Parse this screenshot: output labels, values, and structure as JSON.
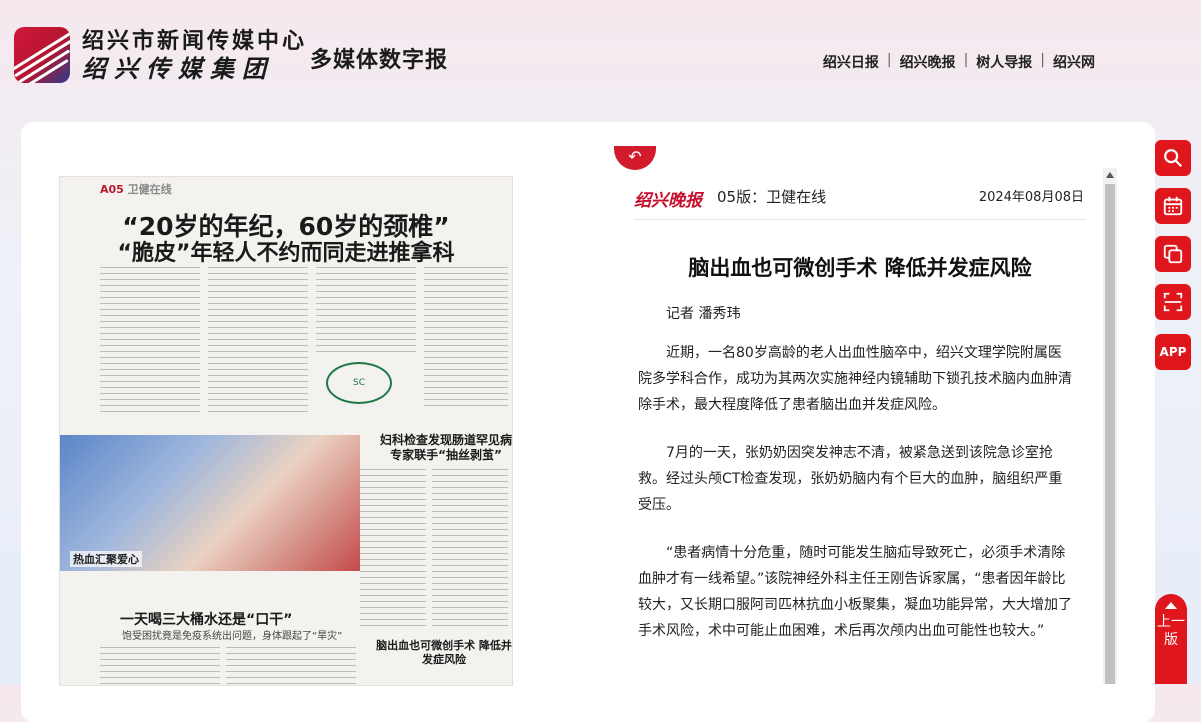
{
  "header": {
    "org_name_line1": "绍兴市新闻传媒中心",
    "org_name_line2": "绍兴传媒集团",
    "product_title": "多媒体数字报",
    "nav": [
      "绍兴日报",
      "绍兴晚报",
      "树人导报",
      "绍兴网"
    ]
  },
  "newspaper_page": {
    "page_tag": "A05",
    "section": "卫健在线",
    "headline_line1": "“20岁的年纪，60岁的颈椎”",
    "headline_line2": "“脆皮”年轻人不约而同走进推拿科",
    "photo_caption": "热血汇聚爱心",
    "subhead_1": "妇科检查发现肠道罕见病 专家联手“抽丝剥茧”",
    "subhead_2": "一天喝三大桶水还是“口干”",
    "subhead_2_sub": "饱受困扰竟是免疫系统出问题，身体跟起了“旱灾”",
    "subhead_3": "脑出血也可微创手术 降低并发症风险",
    "seal_text": "SC"
  },
  "article": {
    "brand": "绍兴晚报",
    "edition": "05版：卫健在线",
    "date": "2024年08月08日",
    "title": "脑出血也可微创手术 降低并发症风险",
    "author": "记者 潘秀玮",
    "paragraphs": [
      "近期，一名80岁高龄的老人出血性脑卒中，绍兴文理学院附属医院多学科合作，成功为其两次实施神经内镜辅助下锁孔技术脑内血肿清除手术，最大程度降低了患者脑出血并发症风险。",
      "7月的一天，张奶奶因突发神志不清，被紧急送到该院急诊室抢救。经过头颅CT检查发现，张奶奶脑内有个巨大的血肿，脑组织严重受压。",
      "“患者病情十分危重，随时可能发生脑疝导致死亡，必须手术清除血肿才有一线希望。”该院神经外科主任王刚告诉家属，“患者因年龄比较大，又长期口服阿司匹林抗血小板聚集，凝血功能异常，大大增加了手术风险，术中可能止血困难，术后再次颅内出血可能性也较大。”"
    ]
  },
  "tools": {
    "icons": [
      "search-icon",
      "calendar-icon",
      "copy-icon",
      "scan-icon"
    ],
    "app_label": "APP",
    "prev_label": "上一版"
  },
  "colors": {
    "accent": "#e0161d",
    "brand_red": "#c8102e"
  }
}
